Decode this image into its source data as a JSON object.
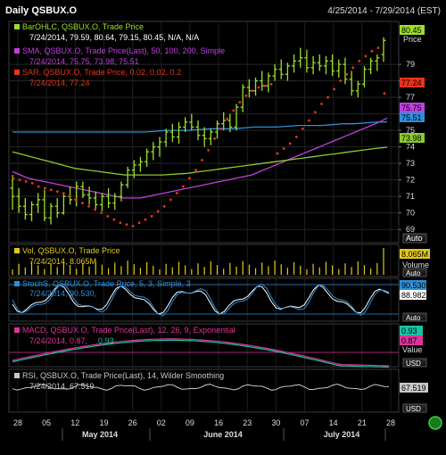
{
  "header": {
    "title": "Daily QSBUX.O",
    "range": "4/25/2014 - 7/29/2014 (EST)"
  },
  "colors": {
    "background": "#000000",
    "bar": "#9BE02A",
    "sar": "#E8341C",
    "sma50": "#C040E0",
    "sma100": "#2E8FD8",
    "sma200": "#8CCB2E",
    "legend_white": "#FFFFFF",
    "volume": "#E0C81C",
    "stoch_k": "#2E8FD8",
    "stoch_d": "#FFFFFF",
    "macd_line": "#E0339A",
    "macd_signal": "#18C2A6",
    "rsi": "#C8C8C8",
    "panel_border": "#3A3A3A"
  },
  "price_panel": {
    "legend": [
      {
        "text": "BarOHLC, QSBUX.O, Trade Price",
        "values": "7/24/2014, 79.59, 80.64, 79.15, 80.45, N/A, N/A"
      },
      {
        "text": "SMA, QSBUX.O, Trade Price(Last),  50, 100, 200, Simple",
        "values": "7/24/2014, 75.75, 73.98, 75.51"
      },
      {
        "text": "SAR, QSBUX.O, Trade Price,  0.02, 0.02, 0.2",
        "values": "7/24/2014, 77.24"
      }
    ],
    "axis_label": "Price",
    "auto_label": "Auto",
    "tags": [
      {
        "value": "80.45",
        "color": "#9BE02A"
      },
      {
        "value": "77.24",
        "color": "#E8341C"
      },
      {
        "value": "75.75",
        "color": "#C040E0"
      },
      {
        "value": "75.51",
        "color": "#2E8FD8"
      },
      {
        "value": "73.98",
        "color": "#8CCB2E"
      }
    ]
  },
  "volume_panel": {
    "legend": "Vol, QSBUX.O, Trade Price",
    "values": "7/24/2014, 8.065M",
    "tag": "8.065M",
    "axis_label": "Volume",
    "auto_label": "Auto"
  },
  "stoch_panel": {
    "legend": "StochS, QSBUX.O, Trade Price,  5, 3, Simple, 3",
    "values": "7/24/2014, 90.530, ",
    "tags": [
      "90.530",
      "88.982"
    ],
    "auto_label": "Auto"
  },
  "macd_panel": {
    "legend": "MACD, QSBUX.O, Trade Price(Last),  12, 26, 9, Exponential",
    "values_a": "7/24/2014, 0.87, ",
    "values_b": "0.93",
    "tags": [
      "0.93",
      "0.87"
    ],
    "axis_label": "Value",
    "auto_label": "USD"
  },
  "rsi_panel": {
    "legend": "RSI, QSBUX.O, Trade Price(Last),  14, Wilder Smoothing",
    "values": "7/24/2014, 67.519",
    "tag": "67.519",
    "auto_label": "USD"
  },
  "x_axis": {
    "day_ticks": [
      "28",
      "05",
      "12",
      "19",
      "26",
      "02",
      "09",
      "16",
      "23",
      "30",
      "07",
      "14",
      "21",
      "28"
    ],
    "months": [
      "May 2014",
      "June 2014",
      "July 2014"
    ]
  },
  "chart_data": {
    "type": "line",
    "title": "Daily QSBUX.O",
    "subtitle": "4/25/2014 - 7/29/2014 (EST)",
    "ylabel": "Price",
    "price_ylim": [
      68.2,
      81.6
    ],
    "y_ticks": [
      69,
      70,
      71,
      72,
      73,
      74,
      75,
      76,
      77,
      78,
      79
    ],
    "grid": true,
    "last_bar": {
      "date": "7/24/2014",
      "open": 79.59,
      "high": 80.64,
      "low": 79.15,
      "close": 80.45
    },
    "bars": [
      [
        71.5,
        72.3,
        70.2,
        71.0
      ],
      [
        71.0,
        71.5,
        70.0,
        70.4
      ],
      [
        70.4,
        70.9,
        69.6,
        69.9
      ],
      [
        69.9,
        70.7,
        69.5,
        70.5
      ],
      [
        70.5,
        71.2,
        70.0,
        70.8
      ],
      [
        70.8,
        71.4,
        69.5,
        69.7
      ],
      [
        69.7,
        70.6,
        69.3,
        70.4
      ],
      [
        70.4,
        70.9,
        69.7,
        70.0
      ],
      [
        70.0,
        71.2,
        69.9,
        71.0
      ],
      [
        71.0,
        71.6,
        70.5,
        70.8
      ],
      [
        70.8,
        71.9,
        70.4,
        71.6
      ],
      [
        71.6,
        71.9,
        70.9,
        71.1
      ],
      [
        71.1,
        71.6,
        70.5,
        70.9
      ],
      [
        70.9,
        71.3,
        70.2,
        70.5
      ],
      [
        70.5,
        71.2,
        70.1,
        71.0
      ],
      [
        71.0,
        71.5,
        70.3,
        70.6
      ],
      [
        70.6,
        71.2,
        70.2,
        71.0
      ],
      [
        71.0,
        71.9,
        70.7,
        71.7
      ],
      [
        71.7,
        72.8,
        71.5,
        72.6
      ],
      [
        72.6,
        73.2,
        72.1,
        72.9
      ],
      [
        72.9,
        73.4,
        72.5,
        73.1
      ],
      [
        73.1,
        73.9,
        72.8,
        73.7
      ],
      [
        73.7,
        74.3,
        73.2,
        74.0
      ],
      [
        74.0,
        74.6,
        73.4,
        74.3
      ],
      [
        74.3,
        75.1,
        74.0,
        74.9
      ],
      [
        74.9,
        75.4,
        74.3,
        74.6
      ],
      [
        74.6,
        75.5,
        74.2,
        75.2
      ],
      [
        75.2,
        75.8,
        74.9,
        75.5
      ],
      [
        75.5,
        76.0,
        75.0,
        75.2
      ],
      [
        75.2,
        75.6,
        74.4,
        74.7
      ],
      [
        74.7,
        75.2,
        74.0,
        74.5
      ],
      [
        74.5,
        75.1,
        74.1,
        74.9
      ],
      [
        74.9,
        75.6,
        74.5,
        75.4
      ],
      [
        75.4,
        76.1,
        75.0,
        75.6
      ],
      [
        75.6,
        76.0,
        74.9,
        75.2
      ],
      [
        75.2,
        76.6,
        75.0,
        76.4
      ],
      [
        76.4,
        77.8,
        76.1,
        77.6
      ],
      [
        77.6,
        78.1,
        77.0,
        77.4
      ],
      [
        77.4,
        78.2,
        77.1,
        78.0
      ],
      [
        78.0,
        78.6,
        77.4,
        77.7
      ],
      [
        77.7,
        78.5,
        77.3,
        78.3
      ],
      [
        78.3,
        79.0,
        78.0,
        78.7
      ],
      [
        78.7,
        79.3,
        78.1,
        78.4
      ],
      [
        78.4,
        79.1,
        78.0,
        78.9
      ],
      [
        78.9,
        79.6,
        78.5,
        79.2
      ],
      [
        79.2,
        80.0,
        78.8,
        79.4
      ],
      [
        79.4,
        79.9,
        78.5,
        78.8
      ],
      [
        78.8,
        79.5,
        78.4,
        79.1
      ],
      [
        79.1,
        79.6,
        78.6,
        78.9
      ],
      [
        78.9,
        79.5,
        78.4,
        79.2
      ],
      [
        79.2,
        79.6,
        78.3,
        78.6
      ],
      [
        78.6,
        79.3,
        78.2,
        79.0
      ],
      [
        79.0,
        79.4,
        77.8,
        78.1
      ],
      [
        78.1,
        78.6,
        77.1,
        77.4
      ],
      [
        77.4,
        78.0,
        77.0,
        77.8
      ],
      [
        77.8,
        78.9,
        77.6,
        78.7
      ],
      [
        78.7,
        79.4,
        78.4,
        79.2
      ],
      [
        79.2,
        79.6,
        78.6,
        79.4
      ],
      [
        79.59,
        80.64,
        79.15,
        80.45
      ]
    ],
    "series": [
      {
        "name": "SAR",
        "values": [
          72.1,
          72.0,
          71.9,
          71.8,
          71.6,
          71.5,
          71.4,
          71.3,
          71.2,
          71.0,
          70.8,
          70.6,
          70.4,
          70.2,
          70.0,
          69.8,
          69.6,
          69.4,
          69.3,
          69.2,
          69.4,
          69.6,
          69.8,
          70.1,
          70.4,
          70.8,
          71.2,
          71.6,
          72.1,
          72.6,
          73.2,
          73.8,
          74.5,
          75.1,
          75.7,
          76.2,
          76.7,
          77.1,
          77.4,
          77.6,
          77.7,
          77.8,
          73.6,
          73.9,
          74.2,
          74.6,
          75.1,
          75.6,
          76.1,
          76.6,
          77.0,
          77.5,
          78.0,
          78.4,
          78.8,
          79.2,
          79.5,
          79.8,
          80.0,
          77.24
        ]
      },
      {
        "name": "SMA 50",
        "values": [
          72.5,
          72.3,
          72.1,
          72.0,
          71.9,
          71.8,
          71.7,
          71.6,
          71.5,
          71.4,
          71.3,
          71.2,
          71.1,
          71.0,
          70.9,
          70.9,
          70.9,
          71.0,
          71.1,
          71.2,
          71.3,
          71.4,
          71.5,
          71.6,
          71.7,
          71.8,
          71.9,
          72.0,
          72.1,
          72.2,
          72.3,
          72.5,
          72.7,
          72.9,
          73.1,
          73.3,
          73.5,
          73.7,
          73.9,
          74.1,
          74.3,
          74.5,
          74.7,
          74.9,
          75.1,
          75.3,
          75.5,
          75.75
        ]
      },
      {
        "name": "SMA 100",
        "values": [
          74.9,
          74.9,
          74.9,
          74.9,
          74.9,
          74.9,
          74.9,
          74.9,
          74.9,
          74.9,
          74.9,
          74.9,
          74.9,
          74.95,
          75.0,
          75.0,
          75.0,
          75.05,
          75.1,
          75.1,
          75.1,
          75.15,
          75.2,
          75.2,
          75.2,
          75.25,
          75.3,
          75.3,
          75.3,
          75.35,
          75.4,
          75.4,
          75.45,
          75.5,
          75.51
        ]
      },
      {
        "name": "SMA 200",
        "values": [
          73.7,
          73.5,
          73.3,
          73.1,
          72.9,
          72.7,
          72.6,
          72.5,
          72.4,
          72.3,
          72.3,
          72.3,
          72.3,
          72.35,
          72.4,
          72.5,
          72.6,
          72.7,
          72.8,
          72.9,
          73.0,
          73.1,
          73.2,
          73.3,
          73.4,
          73.5,
          73.6,
          73.7,
          73.8,
          73.9,
          73.98
        ]
      }
    ],
    "volume_last": "8.065M",
    "stoch_last": [
      90.53,
      88.982
    ],
    "macd_last": [
      0.87,
      0.93
    ],
    "rsi_last": 67.519
  }
}
